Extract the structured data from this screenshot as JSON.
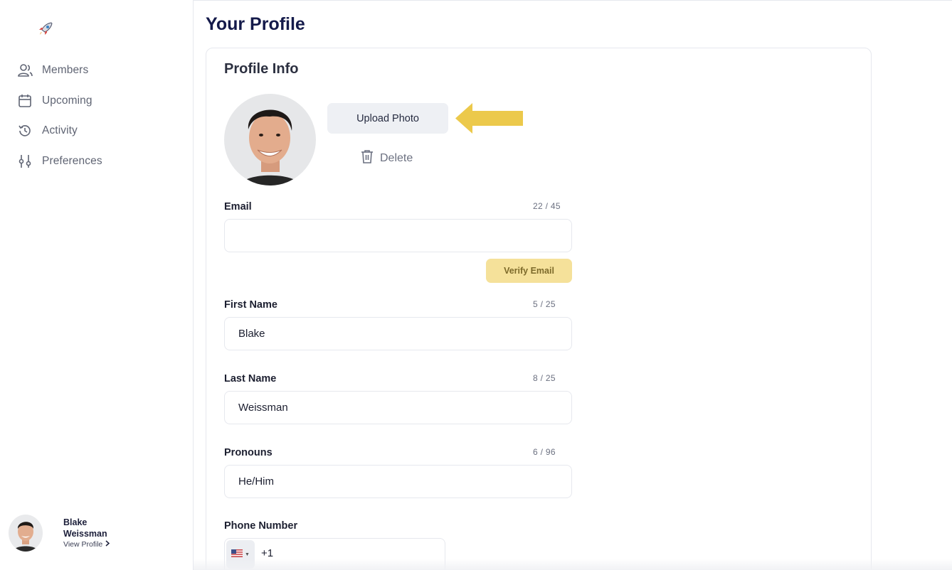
{
  "page": {
    "title": "Your Profile"
  },
  "sidebar": {
    "logo_icon": "rocket-icon",
    "items": [
      {
        "label": "Members",
        "icon": "members-icon"
      },
      {
        "label": "Upcoming",
        "icon": "calendar-icon"
      },
      {
        "label": "Activity",
        "icon": "history-icon"
      },
      {
        "label": "Preferences",
        "icon": "sliders-icon"
      }
    ],
    "user": {
      "first_name": "Blake",
      "last_name": "Weissman",
      "view_profile": "View Profile"
    }
  },
  "profile_info": {
    "title": "Profile Info",
    "upload_label": "Upload Photo",
    "delete_label": "Delete",
    "fields": {
      "email": {
        "label": "Email",
        "counter": "22 / 45",
        "value": ""
      },
      "verify_label": "Verify Email",
      "first_name": {
        "label": "First Name",
        "counter": "5 / 25",
        "value": "Blake"
      },
      "last_name": {
        "label": "Last Name",
        "counter": "8 / 25",
        "value": "Weissman"
      },
      "pronouns": {
        "label": "Pronouns",
        "counter": "6 / 96",
        "value": "He/Him"
      },
      "phone": {
        "label": "Phone Number",
        "country_icon": "us-flag-icon",
        "dial_code": "+1"
      }
    }
  },
  "colors": {
    "accent_yellow": "#f5e19a",
    "arrow_yellow": "#ecc94b",
    "title_navy": "#141a4a"
  }
}
